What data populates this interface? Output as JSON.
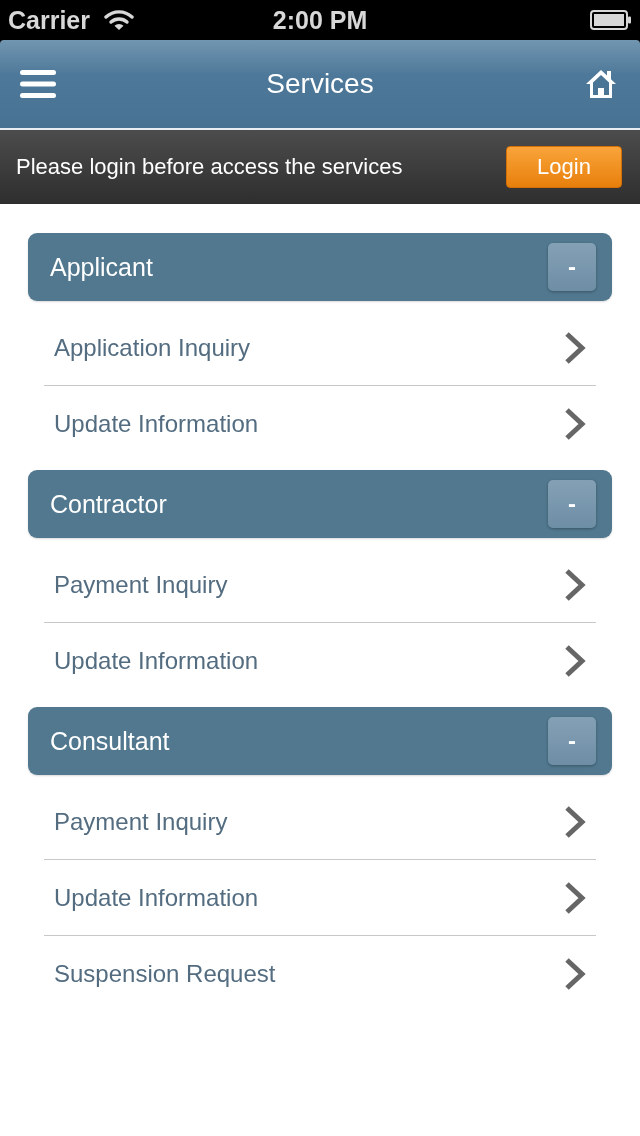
{
  "status_bar": {
    "carrier": "Carrier",
    "time": "2:00 PM"
  },
  "nav_bar": {
    "title": "Services"
  },
  "login_bar": {
    "message": "Please login before access the services",
    "button": "Login"
  },
  "sections": [
    {
      "title": "Applicant",
      "toggle": "-",
      "expanded": true,
      "items": [
        "Application Inquiry",
        "Update Information"
      ]
    },
    {
      "title": "Contractor",
      "toggle": "-",
      "expanded": true,
      "items": [
        "Payment Inquiry",
        "Update Information"
      ]
    },
    {
      "title": "Consultant",
      "toggle": "-",
      "expanded": true,
      "items": [
        "Payment Inquiry",
        "Update Information",
        "Suspension Request"
      ]
    }
  ]
}
